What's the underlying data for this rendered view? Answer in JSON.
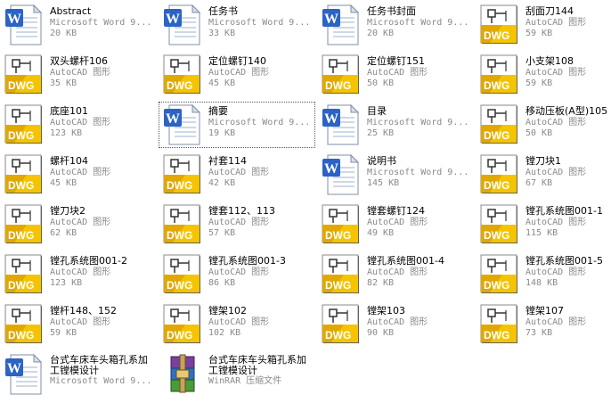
{
  "files": [
    {
      "name": "Abstract",
      "type": "Microsoft Word 9...",
      "size": "20 KB",
      "icon": "word"
    },
    {
      "name": "任务书",
      "type": "Microsoft Word 9...",
      "size": "33 KB",
      "icon": "word"
    },
    {
      "name": "任务书封面",
      "type": "Microsoft Word 9...",
      "size": "20 KB",
      "icon": "word"
    },
    {
      "name": "刮面刀144",
      "type": "AutoCAD 图形",
      "size": "59 KB",
      "icon": "dwg"
    },
    {
      "name": "双头螺杆106",
      "type": "AutoCAD 图形",
      "size": "35 KB",
      "icon": "dwg"
    },
    {
      "name": "定位螺钉140",
      "type": "AutoCAD 图形",
      "size": "45 KB",
      "icon": "dwg"
    },
    {
      "name": "定位螺钉151",
      "type": "AutoCAD 图形",
      "size": "50 KB",
      "icon": "dwg"
    },
    {
      "name": "小支架108",
      "type": "AutoCAD 图形",
      "size": "59 KB",
      "icon": "dwg"
    },
    {
      "name": "底座101",
      "type": "AutoCAD 图形",
      "size": "123 KB",
      "icon": "dwg"
    },
    {
      "name": "摘要",
      "type": "Microsoft Word 9...",
      "size": "19 KB",
      "icon": "word",
      "selected": true
    },
    {
      "name": "目录",
      "type": "Microsoft Word 9...",
      "size": "25 KB",
      "icon": "word"
    },
    {
      "name": "移动压板(A型)105",
      "type": "AutoCAD 图形",
      "size": "50 KB",
      "icon": "dwg"
    },
    {
      "name": "螺杆104",
      "type": "AutoCAD 图形",
      "size": "45 KB",
      "icon": "dwg"
    },
    {
      "name": "衬套114",
      "type": "AutoCAD 图形",
      "size": "42 KB",
      "icon": "dwg"
    },
    {
      "name": "说明书",
      "type": "Microsoft Word 9...",
      "size": "145 KB",
      "icon": "word"
    },
    {
      "name": "镗刀块1",
      "type": "AutoCAD 图形",
      "size": "67 KB",
      "icon": "dwg"
    },
    {
      "name": "镗刀块2",
      "type": "AutoCAD 图形",
      "size": "62 KB",
      "icon": "dwg"
    },
    {
      "name": "镗套112、113",
      "type": "AutoCAD 图形",
      "size": "57 KB",
      "icon": "dwg"
    },
    {
      "name": "镗套螺钉124",
      "type": "AutoCAD 图形",
      "size": "49 KB",
      "icon": "dwg"
    },
    {
      "name": "镗孔系统图001-1",
      "type": "AutoCAD 图形",
      "size": "115 KB",
      "icon": "dwg"
    },
    {
      "name": "镗孔系统图001-2",
      "type": "AutoCAD 图形",
      "size": "123 KB",
      "icon": "dwg"
    },
    {
      "name": "镗孔系统图001-3",
      "type": "AutoCAD 图形",
      "size": "86 KB",
      "icon": "dwg"
    },
    {
      "name": "镗孔系统图001-4",
      "type": "AutoCAD 图形",
      "size": "82 KB",
      "icon": "dwg"
    },
    {
      "name": "镗孔系统图001-5",
      "type": "AutoCAD 图形",
      "size": "148 KB",
      "icon": "dwg"
    },
    {
      "name": "镗杆148、152",
      "type": "AutoCAD 图形",
      "size": "59 KB",
      "icon": "dwg"
    },
    {
      "name": "镗架102",
      "type": "AutoCAD 图形",
      "size": "102 KB",
      "icon": "dwg"
    },
    {
      "name": "镗架103",
      "type": "AutoCAD 图形",
      "size": "90 KB",
      "icon": "dwg"
    },
    {
      "name": "镗架107",
      "type": "AutoCAD 图形",
      "size": "73 KB",
      "icon": "dwg"
    },
    {
      "name": "台式车床车头箱孔系加工镗模设计",
      "type": "Microsoft Word 9...",
      "size": "",
      "icon": "word"
    },
    {
      "name": "台式车床车头箱孔系加工镗模设计",
      "type": "WinRAR 压缩文件",
      "size": "",
      "icon": "rar"
    }
  ],
  "icon_labels": {
    "dwg": "DWG",
    "word": "W"
  }
}
